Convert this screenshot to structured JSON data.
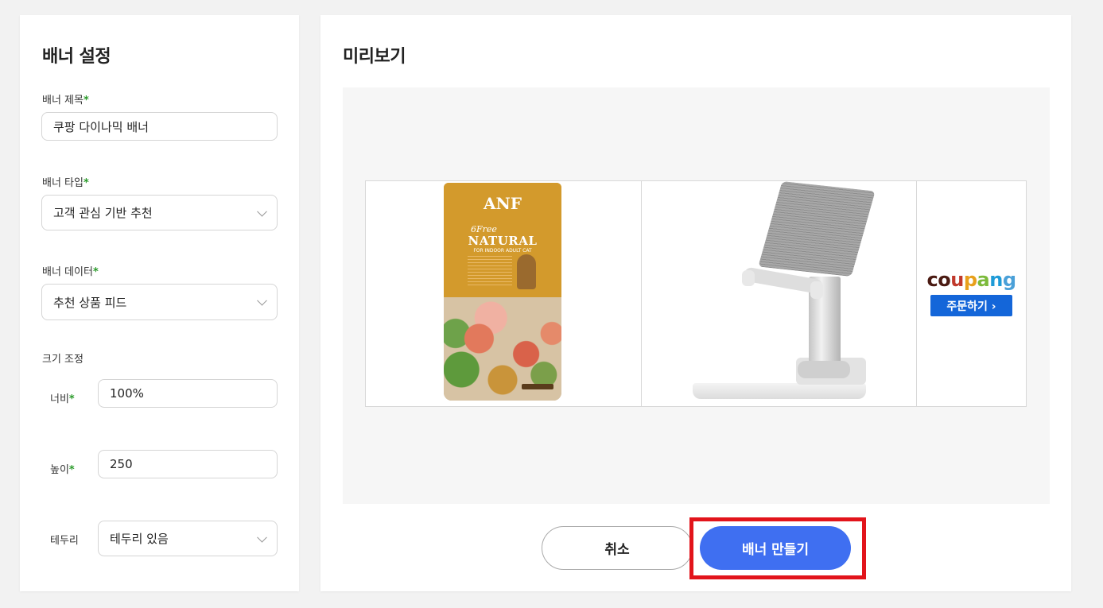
{
  "settings": {
    "title": "배너 설정",
    "banner_title": {
      "label": "배너 제목",
      "value": "쿠팡 다이나믹 배너"
    },
    "banner_type": {
      "label": "배너 타입",
      "value": "고객 관심 기반 추천"
    },
    "banner_data": {
      "label": "배너 데이터",
      "value": "추천 상품 피드"
    },
    "size_label": "크기 조정",
    "width": {
      "label": "너비",
      "value": "100%"
    },
    "height": {
      "label": "높이",
      "value": "250"
    },
    "border": {
      "label": "테두리",
      "value": "테두리 있음"
    },
    "required_mark": "*"
  },
  "preview": {
    "title": "미리보기",
    "products": [
      {
        "name": "cat-food-bag",
        "brand": "ANF",
        "line1": "6Free",
        "line2": "NATURAL",
        "line3": "FOR INDOOR ADULT CAT"
      },
      {
        "name": "phone-stand"
      }
    ],
    "coupang": {
      "letters": [
        "c",
        "o",
        "u",
        "p",
        "a",
        "n",
        "g"
      ],
      "letter_colors": [
        "#4a1a12",
        "#4a1a12",
        "#c0392b",
        "#e8a01c",
        "#7cba3b",
        "#1f9bd7",
        "#4aa0d8"
      ],
      "order_label": "주문하기 ›"
    }
  },
  "actions": {
    "cancel_label": "취소",
    "create_label": "배너 만들기"
  },
  "colors": {
    "accent": "#3f6ff1",
    "highlight": "#e2141b",
    "required": "#2a9a2a"
  }
}
